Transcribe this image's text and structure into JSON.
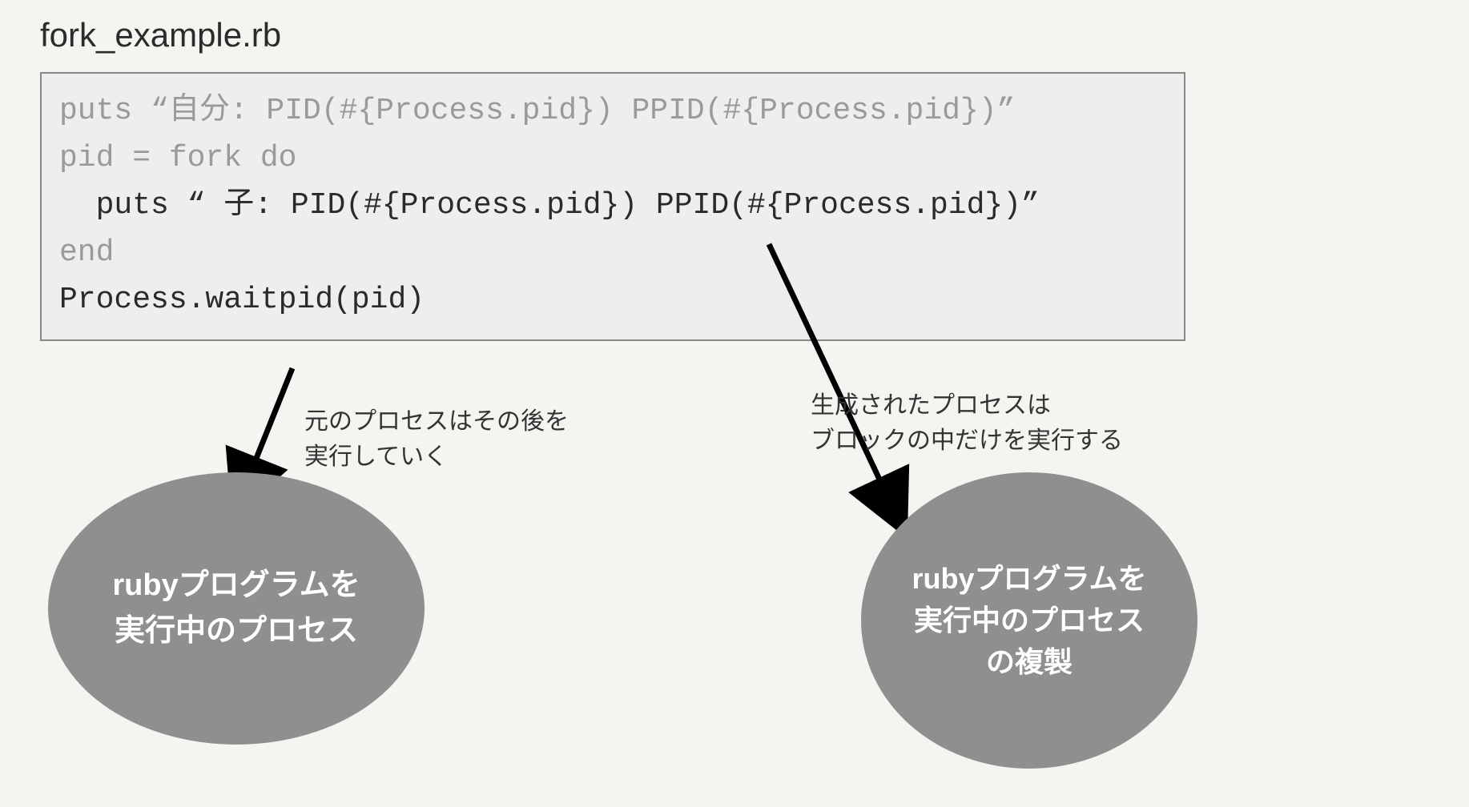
{
  "title": "fork_example.rb",
  "code": {
    "l1": "puts “自分: PID(#{Process.pid}) PPID(#{Process.pid})”",
    "l2": "pid = fork do",
    "l3": "  puts “ 子: PID(#{Process.pid}) PPID(#{Process.pid})”",
    "l4": "end",
    "l5": "Process.waitpid(pid)"
  },
  "notes": {
    "left_l1": "元のプロセスはその後を",
    "left_l2": "実行していく",
    "right_l1": "生成されたプロセスは",
    "right_l2": "ブロックの中だけを実行する"
  },
  "bubbles": {
    "left_l1": "rubyプログラムを",
    "left_l2": "実行中のプロセス",
    "right_l1": "rubyプログラムを",
    "right_l2": "実行中のプロセス",
    "right_l3": "の複製"
  }
}
